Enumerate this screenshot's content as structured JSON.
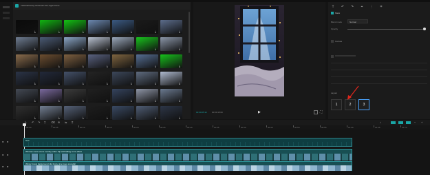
{
  "app": {
    "title": "CapCut Desktop Video Editor"
  },
  "media": {
    "tab_label": "Media",
    "header_path": "material/snowy-christmas-tree-night-scene",
    "thumbnail_colors": [
      [
        "#0a0a0a",
        "#11b511",
        "#13c313",
        "#6b88b0",
        "#3b5a83",
        "#1a1a1a",
        "#5c6d8c"
      ],
      [
        "#6f7d92",
        "#4b5b75",
        "#8aa5c5",
        "#b7c0cf",
        "#9aa7ba",
        "#18c41d",
        "#8b96a8"
      ],
      [
        "#8a6c4c",
        "#6d4e30",
        "#7e6040",
        "#5a6280",
        "#7f6540",
        "#566f93",
        "#16c11b"
      ],
      [
        "#2b3447",
        "#22293a",
        "#44516a",
        "#242424",
        "#3c475a",
        "#5f6c80",
        "#afbad0"
      ],
      [
        "#444a55",
        "#7b6a9e",
        "#3c3c3c",
        "#202020",
        "#35445f",
        "#8e95a6",
        "#6b7a90"
      ],
      [
        "#2f2f2f",
        "#737f92",
        "#556177",
        "#1d1d1d",
        "#3a4a64",
        "#4f5d74",
        "#2d3647"
      ]
    ]
  },
  "preview": {
    "timecode": "00:00:05:12",
    "duration": "00:00:15:00",
    "play_icon": "play-icon"
  },
  "inspector": {
    "section_label": "Mask",
    "row1_label": "Blend mode",
    "row1_value": "Normal",
    "row2_label": "Opacity",
    "canvas_label": "Canvas",
    "layout_label": "Layout",
    "options": [
      "1",
      "2",
      "3"
    ],
    "active_option": "3"
  },
  "timeline": {
    "ruler_labels": [
      "00:00",
      "00:05",
      "00:10",
      "00:15",
      "00:20",
      "00:25",
      "00:30",
      "00:35",
      "00:40",
      "00:45",
      "00:50",
      "00:55",
      "01:00",
      "01:05",
      "01:10"
    ],
    "track1_label": "Text",
    "track2_label": "Window snow scene overlay video clip with falling snow effect",
    "track3_label": "Winter forest background clip frosty pine trees snowfall",
    "accent": "#1aa6a6"
  }
}
